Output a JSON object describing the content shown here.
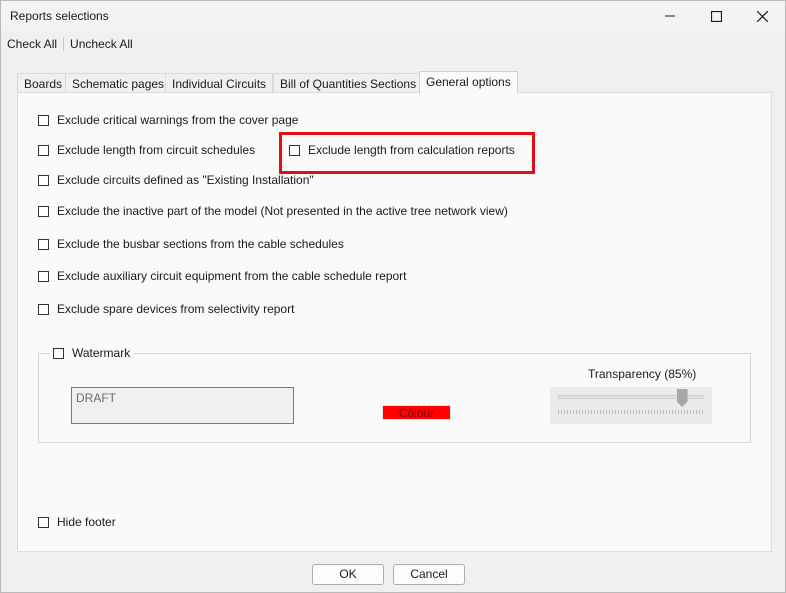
{
  "window": {
    "title": "Reports selections"
  },
  "toolbar": {
    "check_all": "Check All",
    "uncheck_all": "Uncheck All"
  },
  "tabs": [
    {
      "label": "Boards"
    },
    {
      "label": "Schematic pages"
    },
    {
      "label": "Individual Circuits"
    },
    {
      "label": "Bill of Quantities Sections"
    },
    {
      "label": "General options"
    }
  ],
  "options": {
    "exclude_critical_warnings": "Exclude critical warnings from the cover page",
    "exclude_length_circuit_schedules": "Exclude length from circuit schedules",
    "exclude_length_calc_reports": "Exclude length from calculation reports",
    "exclude_existing_installation": "Exclude circuits defined as \"Existing Installation\"",
    "exclude_inactive_part": "Exclude the inactive part of the model (Not presented in the active tree network view)",
    "exclude_busbar_sections": "Exclude the busbar sections from the cable schedules",
    "exclude_auxiliary_equipment": "Exclude auxiliary circuit equipment from the cable schedule report",
    "exclude_spare_devices": "Exclude spare devices from selectivity report"
  },
  "watermark": {
    "label": "Watermark",
    "text_value": "DRAFT",
    "colour_label": "Colour",
    "colour": "#ff0000",
    "transparency_label": "Transparency (85%)",
    "transparency_value": 0.85
  },
  "footer": {
    "hide_footer": "Hide footer"
  },
  "buttons": {
    "ok": "OK",
    "cancel": "Cancel"
  }
}
